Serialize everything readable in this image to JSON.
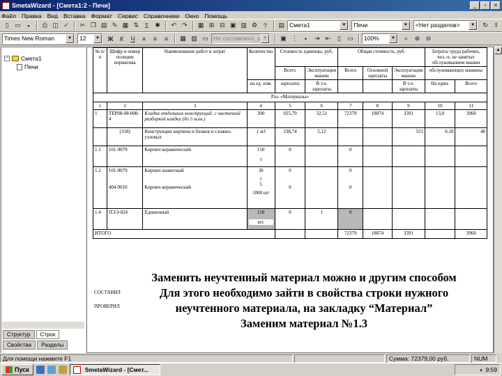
{
  "window": {
    "title": "SmetaWizard - [Смета1:2 - Печи]",
    "controls": [
      "_",
      "▫",
      "×"
    ]
  },
  "menu": [
    "Файл",
    "Правка",
    "Вид",
    "Вставка",
    "Формат",
    "Сервис",
    "Справочники",
    "Окно",
    "Помощь"
  ],
  "toolbar1": {
    "smeta_combo": "Смета1",
    "object_combo": "Печи",
    "section_combo": "<Нет разделов>"
  },
  "toolbar2": {
    "font_combo": "Times New Roman",
    "size_combo": "12",
    "bold": "Ж",
    "italic": "К",
    "underline": "Ч",
    "style_combo": "Не составлено_рез",
    "zoom_combo": "100%"
  },
  "tree": {
    "root": "Смета1",
    "child": "Печи"
  },
  "panel_tabs": {
    "structure": "Структур",
    "rows": "Строк",
    "properties": "Свойства",
    "sections": "Разделы"
  },
  "table": {
    "headers": {
      "num": "№ п/п",
      "code": "Шифр и номер позиции норматива",
      "name": "Наименование работ и затрат",
      "qty": "Количество",
      "unit_cost": "Стоимость единицы, руб.",
      "total_cost": "Общая стоимость, руб.",
      "labor": "Затраты труда рабочих, чел.-ч, не занятых обслуживанием машин",
      "sub_total": "Всего",
      "sub_mach": "Эксплуатации машин",
      "sub_total2": "Всего",
      "sub_base": "Основной зарплаты",
      "sub_mach2": "Эксплуатации машин",
      "sub_serv": "обслуживающих машины",
      "sub_zp": "зарплаты",
      "sub_zp_mach": "В т.ч. зарплаты",
      "sub_zp_mach2": "В т.ч. зарплаты",
      "sub_per_unit": "На един.",
      "sub_all": "Всего",
      "unit_100": "на ед. изм."
    },
    "section_title": "Раз. «Материалы»",
    "col_numbers": [
      "1",
      "2",
      "3",
      "4",
      "5",
      "6",
      "7",
      "8",
      "9",
      "10",
      "11"
    ],
    "rows": [
      {
        "num": "1",
        "code": "ТЕР08-08-008-4",
        "name": "Кладка отдельных конструкций: с частичной разборкой кладки (до 5 м.кв.)",
        "qty": "300",
        "c5": "925,79",
        "c6": "32,51",
        "c7": "72379",
        "c8": "18874",
        "c9": "3391",
        "c10": "13,0",
        "c11": "3960"
      },
      {
        "num": "",
        "code": "(318)",
        "name": "Конструкции кирпича и блоков и сложно-узловых",
        "qty": "1 м3",
        "c5": "338,74",
        "c6": "5,12",
        "c7": "",
        "c8": "",
        "c9": "553",
        "c10": "0,18",
        "c11": "48"
      },
      {
        "num": "1.1",
        "code": "101-9079",
        "name": "Кирпич керамический",
        "qty": "150",
        "qty_unit": "т",
        "c5": "0",
        "c6": "",
        "c7": "0",
        "c8": "",
        "c9": "",
        "c10": "",
        "c11": ""
      },
      {
        "num": "1.2",
        "code": "101-9079",
        "name": "Кирпич шамотный",
        "qty": "30",
        "qty_unit": "т",
        "c5": "0",
        "c6": "",
        "c7": "0",
        "c8": "",
        "c9": "",
        "c10": "",
        "c11": ""
      },
      {
        "num": "",
        "code": "404-9010",
        "name": "Кирпич керамический",
        "qty": "5",
        "qty_unit": "1000 шт",
        "c5": "0",
        "c6": "",
        "c7": "0",
        "c8": "",
        "c9": "",
        "c10": "",
        "c11": ""
      },
      {
        "num": "1.4",
        "code": "ПЭЭ-024",
        "name": "Единичный",
        "qty": "150",
        "qty_unit": "шт.",
        "c5": "0",
        "c6": "1",
        "c7": "0",
        "c8": "",
        "c9": "",
        "c10": "",
        "c11": ""
      }
    ],
    "total_label": "ИТОГО",
    "total": {
      "c7": "72379",
      "c8": "18874",
      "c9": "3391",
      "c11": "3960"
    }
  },
  "under_labels": {
    "l1": "СОСТАВИЛ",
    "l2": "ПРОВЕРИЛ"
  },
  "overlay": {
    "line1": "Заменить неучтенный материал можно и другим способом",
    "line2": "Для этого необходимо зайти в свойства строки нужного",
    "line3": "неучтенного материала, на закладку “Материал”",
    "line4": "Заменим материал №1.3"
  },
  "status": {
    "help": "Для помощи нажмите F1",
    "sum": "Сумма: 72379,00 руб.",
    "mode": "NUM"
  },
  "taskbar": {
    "start": "Пуск",
    "task": "SmetaWizard - [Смет...",
    "clock": "9:59"
  }
}
